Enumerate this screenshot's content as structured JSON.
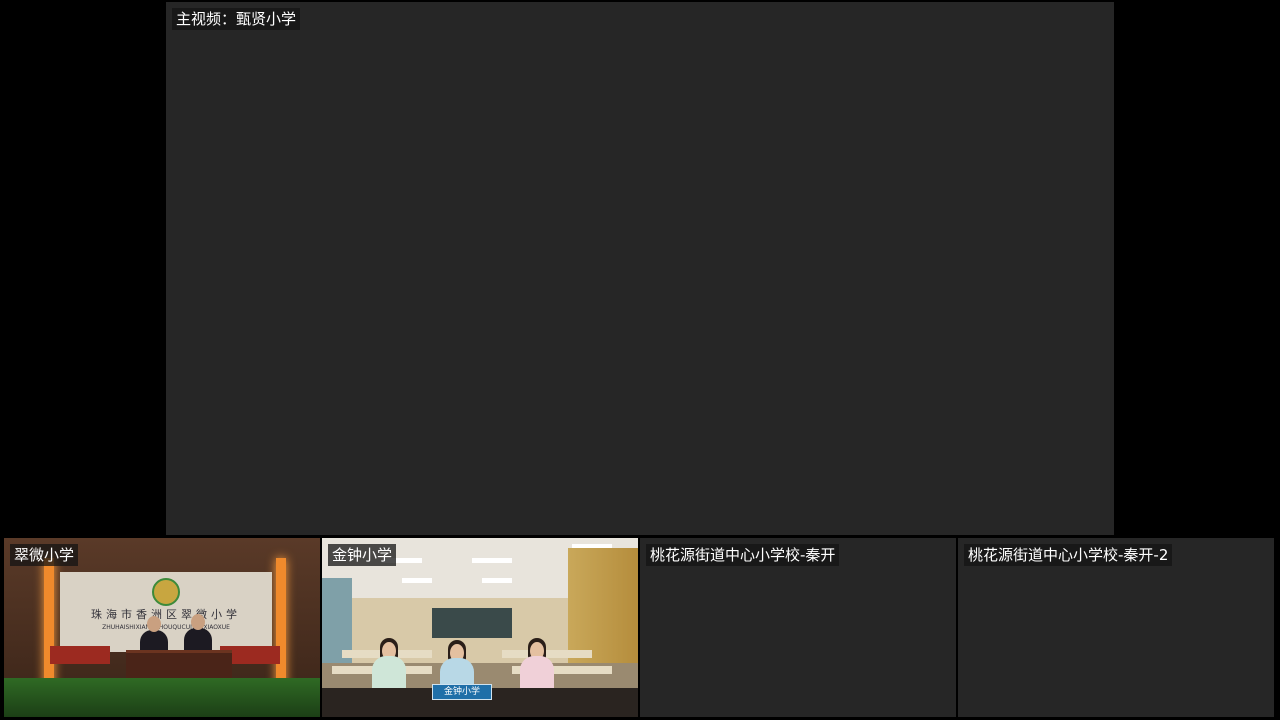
{
  "main": {
    "label": "主视频：甄贤小学"
  },
  "tiles": [
    {
      "label": "翠微小学",
      "nameplate": ""
    },
    {
      "label": "金钟小学",
      "nameplate": "金钟小学"
    },
    {
      "label": "桃花源街道中心小学校-秦开"
    },
    {
      "label": "桃花源街道中心小学校-秦开-2"
    }
  ],
  "scene1": {
    "banner": "珠海市香洲区翠微小学",
    "banner_sub": "ZHUHAISHIXIANGZHOUQUCUIWEIXIAOXUE"
  }
}
